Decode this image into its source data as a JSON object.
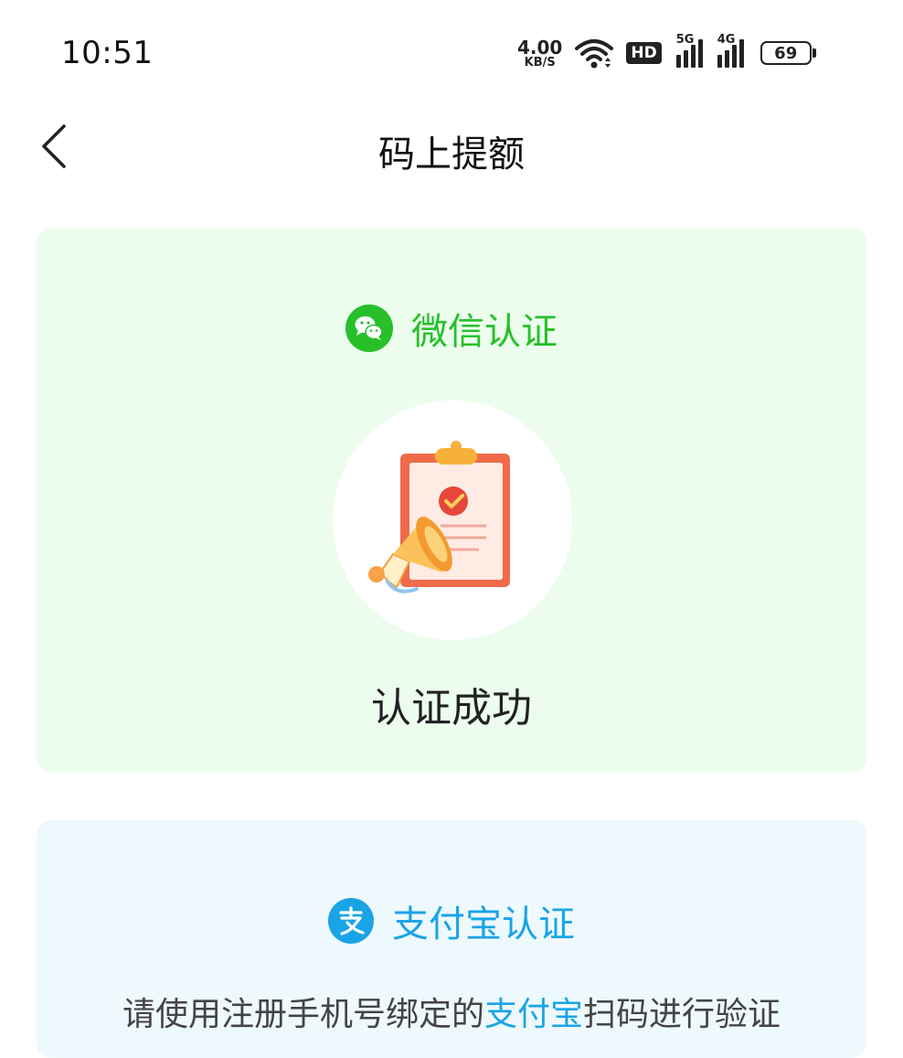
{
  "statusbar": {
    "time": "10:51",
    "net_speed_value": "4.00",
    "net_speed_unit": "KB/S",
    "hd_badge": "HD",
    "sim1_tag": "5G",
    "sim2_tag": "4G",
    "battery": "69"
  },
  "navbar": {
    "title": "码上提额"
  },
  "wechat_card": {
    "title": "微信认证",
    "result": "认证成功",
    "accent": "#27c02a",
    "background": "#ecfdee"
  },
  "alipay_card": {
    "title": "支付宝认证",
    "desc_prefix": "请使用注册手机号绑定的",
    "desc_highlight": "支付宝",
    "desc_suffix": "扫码进行验证",
    "accent": "#1aa4e6",
    "background": "#eef9fe"
  },
  "icons": {
    "back": "chevron-left-icon",
    "wifi": "wifi-icon",
    "wechat": "wechat-icon",
    "alipay": "alipay-icon",
    "illustration": "clipboard-megaphone-icon"
  }
}
